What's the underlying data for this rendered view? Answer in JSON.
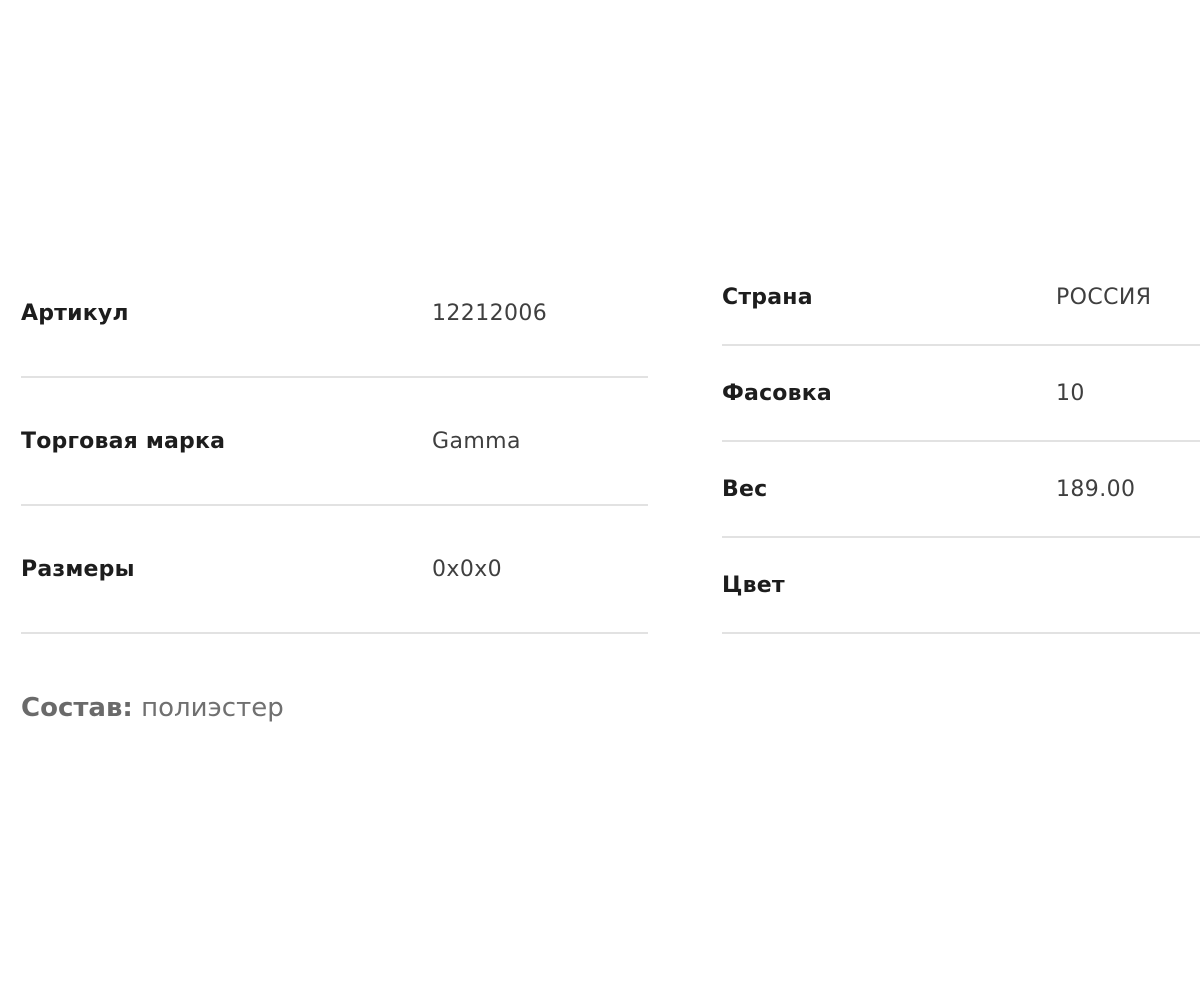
{
  "specs": {
    "left": [
      {
        "label": "Артикул",
        "value": "12212006"
      },
      {
        "label": "Торговая марка",
        "value": "Gamma"
      },
      {
        "label": "Размеры",
        "value": "0x0x0"
      }
    ],
    "right": [
      {
        "label": "Страна",
        "value": "РОССИЯ"
      },
      {
        "label": "Фасовка",
        "value": "10"
      },
      {
        "label": "Вес",
        "value": "189.00"
      },
      {
        "label": "Цвет",
        "value": ""
      }
    ]
  },
  "composition": {
    "label": "Состав:",
    "value": "полиэстер"
  }
}
